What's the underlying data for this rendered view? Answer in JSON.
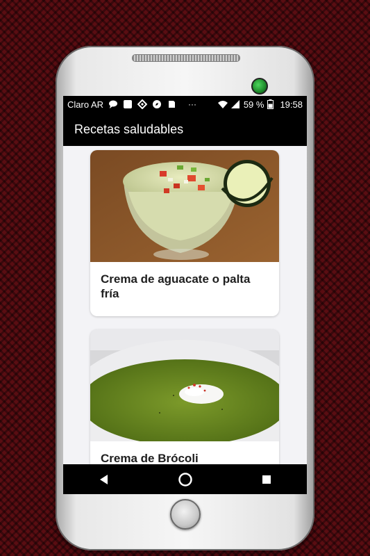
{
  "status_bar": {
    "carrier": "Claro AR",
    "battery": "59 %",
    "time": "19:58",
    "more": "···",
    "icons": [
      "chat-bubble-icon",
      "square-app-icon",
      "binance-icon",
      "compass-icon",
      "clipboard-icon",
      "wifi-icon",
      "signal-icon",
      "battery-icon"
    ]
  },
  "app_bar": {
    "title": "Recetas saludables"
  },
  "recipes": [
    {
      "title": "Crema de aguacate o palta fría",
      "image": "avocado-cream-photo"
    },
    {
      "title": "Crema de Brócoli",
      "image": "broccoli-cream-photo"
    }
  ],
  "nav": {
    "icons": [
      "back-icon",
      "home-icon",
      "recents-icon"
    ]
  },
  "colors": {
    "background": "#5a0d12",
    "bars": "#000000",
    "card": "#ffffff",
    "screen_bg": "#f3f3f6",
    "camera": "#2fbf44"
  }
}
